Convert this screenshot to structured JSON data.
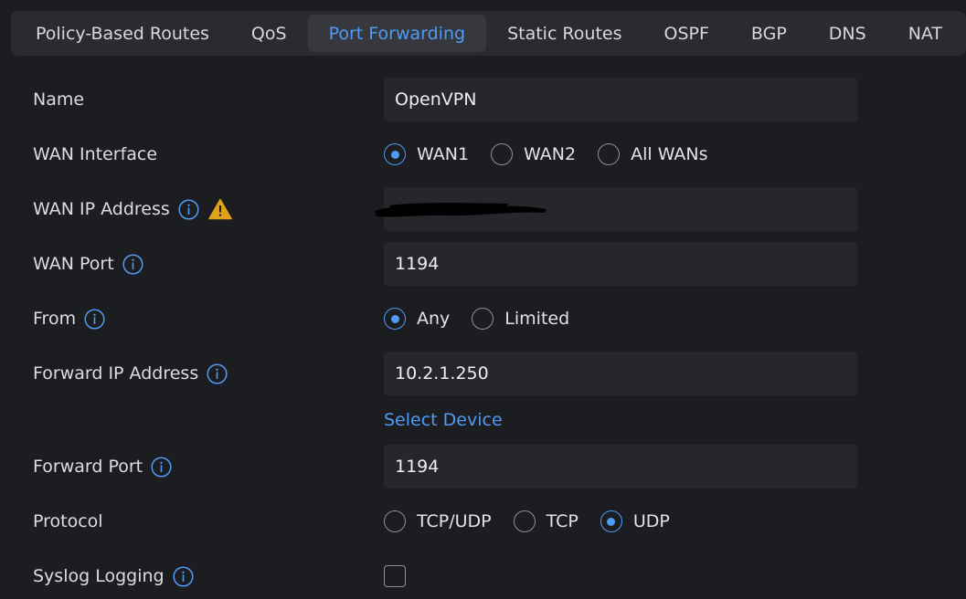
{
  "tabs": [
    {
      "label": "Policy-Based Routes",
      "active": false
    },
    {
      "label": "QoS",
      "active": false
    },
    {
      "label": "Port Forwarding",
      "active": true
    },
    {
      "label": "Static Routes",
      "active": false
    },
    {
      "label": "OSPF",
      "active": false
    },
    {
      "label": "BGP",
      "active": false
    },
    {
      "label": "DNS",
      "active": false
    },
    {
      "label": "NAT",
      "active": false
    }
  ],
  "form": {
    "name": {
      "label": "Name",
      "value": "OpenVPN"
    },
    "wan_interface": {
      "label": "WAN Interface",
      "options": [
        "WAN1",
        "WAN2",
        "All WANs"
      ],
      "selected": "WAN1"
    },
    "wan_ip": {
      "label": "WAN IP Address",
      "value": ""
    },
    "wan_port": {
      "label": "WAN Port",
      "value": "1194"
    },
    "from": {
      "label": "From",
      "options": [
        "Any",
        "Limited"
      ],
      "selected": "Any"
    },
    "forward_ip": {
      "label": "Forward IP Address",
      "value": "10.2.1.250"
    },
    "select_device": "Select Device",
    "forward_port": {
      "label": "Forward Port",
      "value": "1194"
    },
    "protocol": {
      "label": "Protocol",
      "options": [
        "TCP/UDP",
        "TCP",
        "UDP"
      ],
      "selected": "UDP"
    },
    "syslog": {
      "label": "Syslog Logging",
      "checked": false
    }
  },
  "colors": {
    "accent": "#4f9bf5",
    "warning": "#e0a21b",
    "background": "#1c1d21",
    "field": "#26272c"
  },
  "icons": {
    "info": "info-circle-icon",
    "warning": "warning-triangle-icon"
  }
}
